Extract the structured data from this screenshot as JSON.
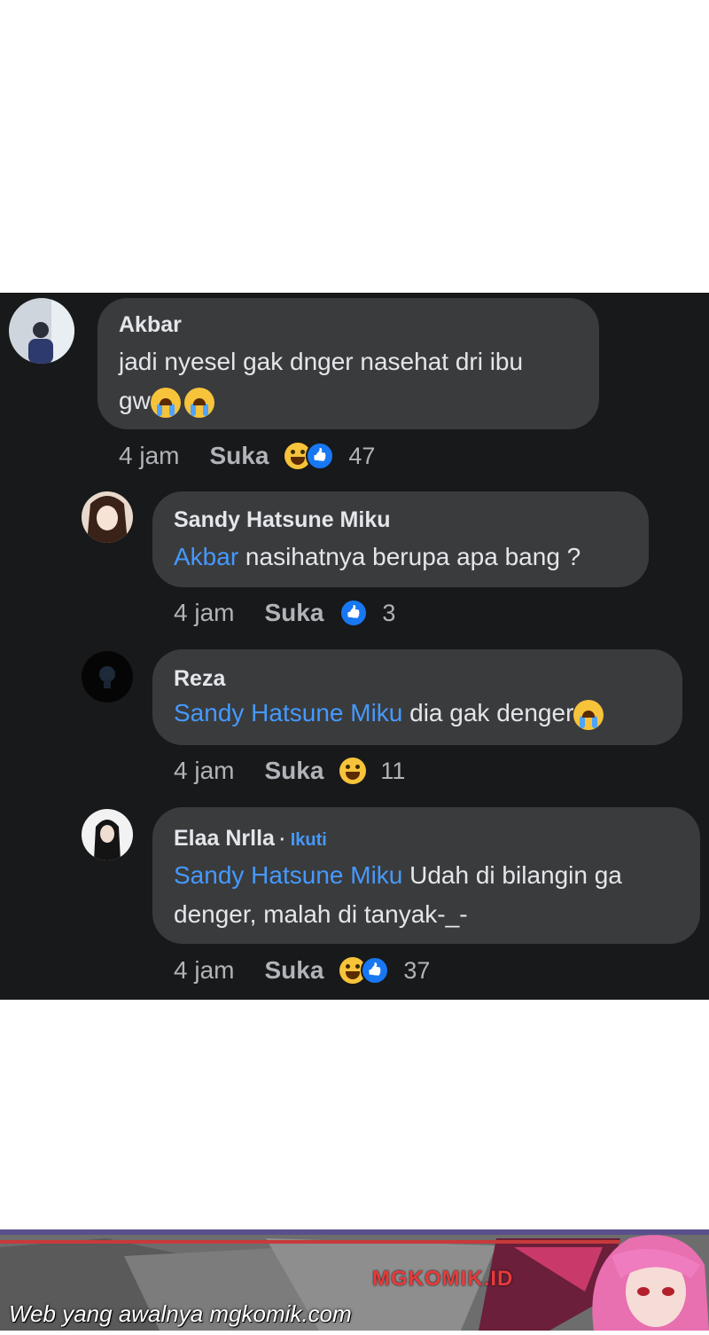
{
  "comments": [
    {
      "author": "Akbar",
      "text_line1": "jadi nyesel gak dnger nasehat dri ibu",
      "text_line2": "gw",
      "time": "4 jam",
      "like_label": "Suka",
      "count": "47"
    },
    {
      "author": "Sandy Hatsune Miku",
      "mention": "Akbar",
      "text": " nasihatnya berupa apa bang ?",
      "time": "4 jam",
      "like_label": "Suka",
      "count": "3"
    },
    {
      "author": "Reza",
      "mention": "Sandy Hatsune Miku",
      "text": " dia gak denger",
      "time": "4 jam",
      "like_label": "Suka",
      "count": "11"
    },
    {
      "author": "Elaa Nrlla",
      "follow_sep": " · ",
      "follow_label": "Ikuti",
      "mention": "Sandy Hatsune Miku",
      "text_line1": " Udah di bilangin ga",
      "text_line2": "denger, malah di tanyak-_-",
      "time": "4 jam",
      "like_label": "Suka",
      "count": "37"
    }
  ],
  "footer": {
    "watermark": "Web yang awalnya mgkomik.com",
    "brand": "MGKOMIK.ID"
  },
  "colors": {
    "background": "#18191a",
    "bubble": "#3a3b3c",
    "mention": "#4599ff",
    "like_blue": "#1877f2"
  }
}
